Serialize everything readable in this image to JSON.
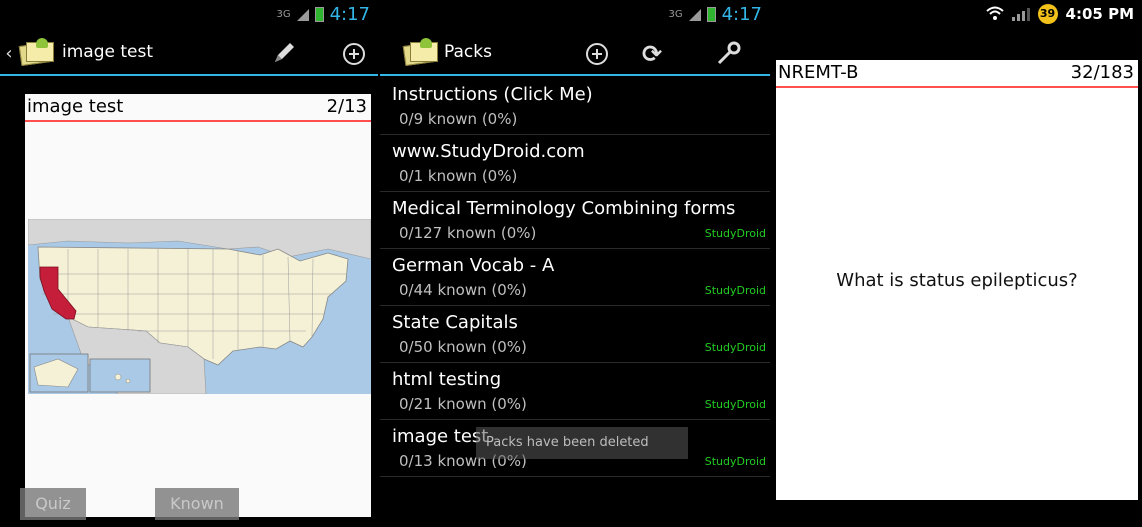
{
  "panel1": {
    "status": {
      "network": "3G",
      "time": "4:17"
    },
    "actionbar": {
      "title": "image test"
    },
    "card": {
      "title": "image test",
      "counter": "2/13"
    },
    "buttons": {
      "quiz": "Quiz",
      "known": "Known"
    }
  },
  "panel2": {
    "status": {
      "network": "3G",
      "time": "4:17"
    },
    "actionbar": {
      "title": "Packs"
    },
    "packs": [
      {
        "title": "Instructions (Click Me)",
        "known": "0/9 known (0%)",
        "source": ""
      },
      {
        "title": "www.StudyDroid.com",
        "known": "0/1 known (0%)",
        "source": ""
      },
      {
        "title": "Medical Terminology Combining forms",
        "known": "0/127 known (0%)",
        "source": "StudyDroid"
      },
      {
        "title": "German Vocab - A",
        "known": "0/44 known (0%)",
        "source": "StudyDroid"
      },
      {
        "title": "State Capitals",
        "known": "0/50 known (0%)",
        "source": "StudyDroid"
      },
      {
        "title": "html testing",
        "known": "0/21 known (0%)",
        "source": "StudyDroid"
      },
      {
        "title": "image test",
        "known": "0/13 known (0%)",
        "source": "StudyDroid"
      }
    ],
    "toast": "Packs have been deleted"
  },
  "panel3": {
    "status": {
      "battery": "39",
      "time": "4:05 PM"
    },
    "card": {
      "title": "NREMT-B",
      "counter": "32/183"
    },
    "question": "What is status epilepticus?"
  },
  "colors": {
    "accent": "#33b5e5",
    "divider": "#ff4f4f",
    "source": "#22cc22",
    "highlight_state": "#c41e3a"
  }
}
